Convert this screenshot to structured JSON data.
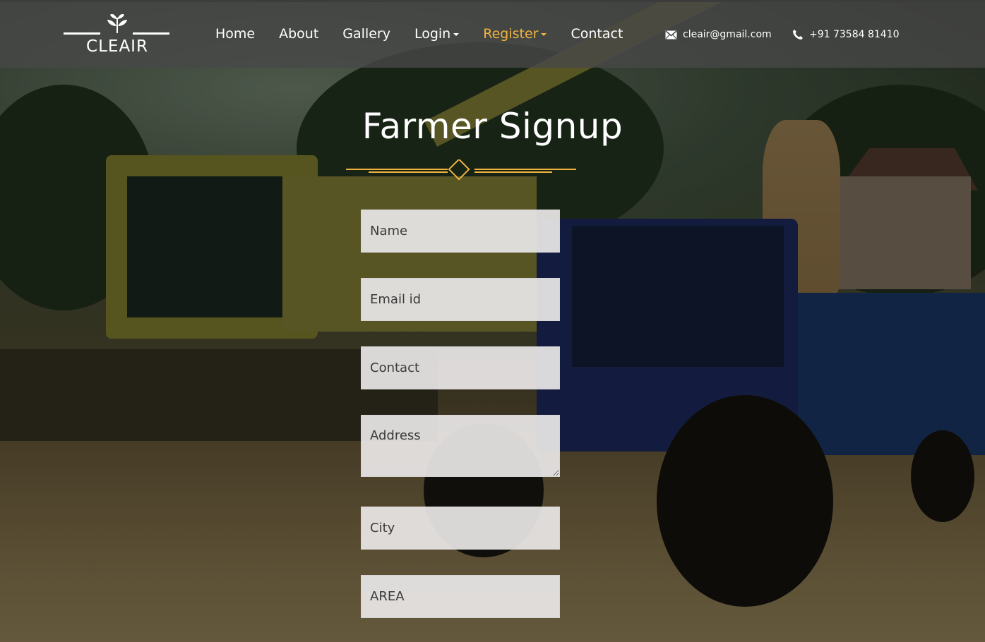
{
  "brand": {
    "name": "CLEAIR"
  },
  "nav": {
    "items": [
      {
        "label": "Home"
      },
      {
        "label": "About"
      },
      {
        "label": "Gallery"
      },
      {
        "label": "Login"
      },
      {
        "label": "Register"
      },
      {
        "label": "Contact"
      }
    ],
    "active_item": "Register",
    "active_color": "#f0b33e"
  },
  "contact": {
    "email": "cleair@gmail.com",
    "phone": "+91 73584 81410",
    "email_icon": "envelope-icon",
    "phone_icon": "phone-icon"
  },
  "page": {
    "title": "Farmer Signup",
    "accent_color": "#f0b33e"
  },
  "form": {
    "name_placeholder": "Name",
    "email_placeholder": "Email id",
    "contact_placeholder": "Contact",
    "address_placeholder": "Address",
    "city_placeholder": "City",
    "area_placeholder": "AREA"
  }
}
